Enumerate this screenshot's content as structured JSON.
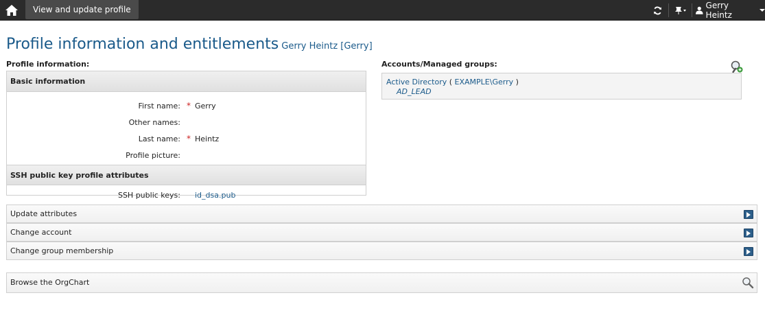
{
  "topbar": {
    "home_icon": "home-icon",
    "active_tab": "View and update profile",
    "refresh_icon": "refresh-icon",
    "pin_icon": "pin-icon",
    "user_icon": "user-icon",
    "user_name": "Gerry Heintz"
  },
  "page": {
    "title": "Profile information and entitlements",
    "subtitle": "Gerry Heintz [Gerry]"
  },
  "profile": {
    "section_label": "Profile information:",
    "basic": {
      "header": "Basic information",
      "fields": [
        {
          "label": "First name:",
          "required": "*",
          "value": "Gerry"
        },
        {
          "label": "Other names:",
          "required": "",
          "value": ""
        },
        {
          "label": "Last name:",
          "required": "*",
          "value": "Heintz"
        },
        {
          "label": "Profile picture:",
          "required": "",
          "value": ""
        }
      ]
    },
    "ssh": {
      "header": "SSH public key profile attributes",
      "label": "SSH public keys:",
      "value": "id_dsa.pub"
    }
  },
  "accounts": {
    "section_label": "Accounts/Managed groups:",
    "system": "Active Directory",
    "open_paren": "(",
    "account": "EXAMPLE\\Gerry",
    "close_paren": ")",
    "group": "AD_LEAD",
    "search_icon": "search-add-icon"
  },
  "actions": [
    {
      "label": "Update attributes",
      "icon": "chevron-right-icon"
    },
    {
      "label": "Change account",
      "icon": "chevron-right-icon"
    },
    {
      "label": "Change group membership",
      "icon": "chevron-right-icon"
    }
  ],
  "orgchart": {
    "label": "Browse the OrgChart",
    "icon": "magnifier-icon"
  },
  "colors": {
    "topbar": "#2b2b2b",
    "link": "#1a5a8a",
    "required": "#cc2222",
    "action_icon": "#2d5f8a"
  }
}
